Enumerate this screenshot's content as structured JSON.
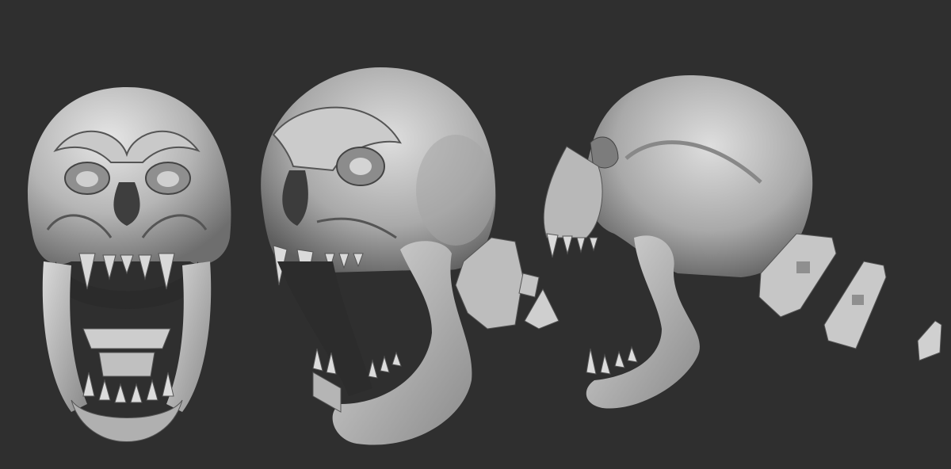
{
  "scene": {
    "subject": "skull-sculpt-turnaround",
    "background_color": "#2f2f2f",
    "material_color": "#b9b9b9",
    "views": [
      {
        "name": "front-view"
      },
      {
        "name": "three-quarter-view"
      },
      {
        "name": "side-view"
      }
    ]
  }
}
